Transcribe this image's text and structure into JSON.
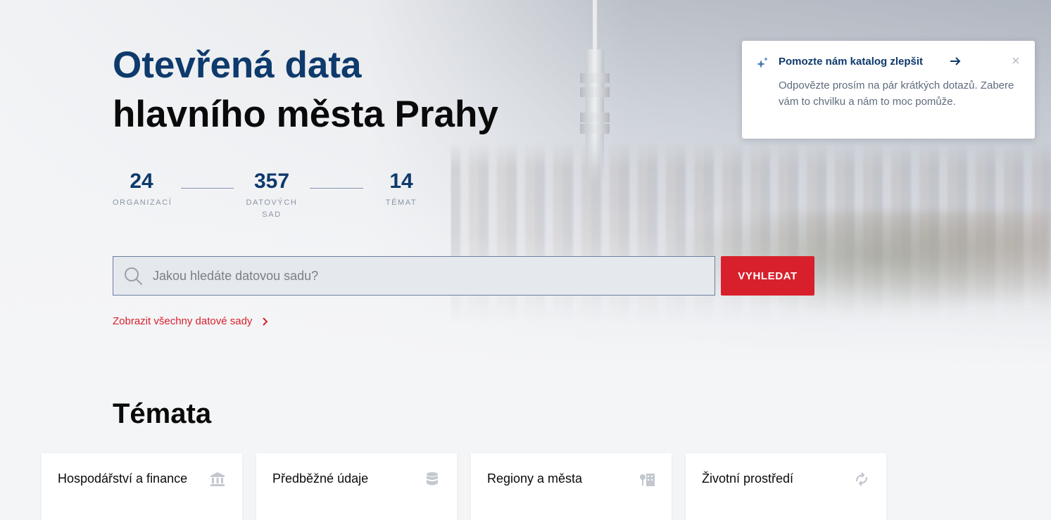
{
  "hero": {
    "title_line1": "Otevřená data",
    "title_line2": "hlavního města Prahy"
  },
  "stats": [
    {
      "value": "24",
      "label": "ORGANIZACÍ"
    },
    {
      "value": "357",
      "label": "DATOVÝCH SAD"
    },
    {
      "value": "14",
      "label": "TÉMAT"
    }
  ],
  "search": {
    "placeholder": "Jakou hledáte datovou sadu?",
    "button_label": "VYHLEDAT",
    "icon": "search-icon"
  },
  "all_datasets_link": "Zobrazit všechny datové sady",
  "topics": {
    "title": "Témata",
    "items": [
      {
        "label": "Hospodářství a finance",
        "icon": "bank-icon"
      },
      {
        "label": "Předběžné údaje",
        "icon": "database-icon"
      },
      {
        "label": "Regiony a města",
        "icon": "city-icon"
      },
      {
        "label": "Životní prostředí",
        "icon": "recycle-icon"
      }
    ]
  },
  "feedback": {
    "title": "Pomozte nám katalog zlepšit",
    "text": "Odpovězte prosím na pár krátkých dotazů. Zabere vám to chvilku a nám to moc pomůže.",
    "close_label": "×"
  },
  "colors": {
    "brand_blue": "#0e3a6c",
    "accent_red": "#d8202c",
    "muted_text": "#8a95a3"
  }
}
